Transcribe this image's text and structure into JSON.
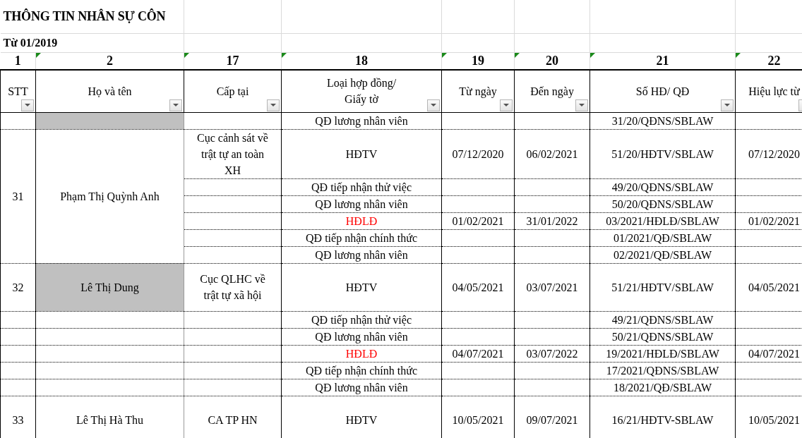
{
  "sheet": {
    "title": "THÔNG TIN NHÂN SỰ CÔN",
    "subtitle": "Từ 01/2019"
  },
  "table": {
    "columns": [
      {
        "number": "1",
        "title": "STT",
        "flagged": false,
        "filter": true
      },
      {
        "number": "2",
        "title": "Họ và tên",
        "flagged": true,
        "filter": true
      },
      {
        "number": "17",
        "title": "Cấp tại",
        "flagged": true,
        "filter": true
      },
      {
        "number": "18",
        "title": "Loại hợp đồng/\nGiấy tờ",
        "flagged": true,
        "filter": true
      },
      {
        "number": "19",
        "title": "Từ ngày",
        "flagged": true,
        "filter": true
      },
      {
        "number": "20",
        "title": "Đến ngày",
        "flagged": true,
        "filter": true
      },
      {
        "number": "21",
        "title": "Số HĐ/ QĐ",
        "flagged": true,
        "filter": true
      },
      {
        "number": "22",
        "title": "Hiệu lực từ",
        "flagged": true,
        "filter": true
      }
    ],
    "persons": [
      {
        "highlighted": true,
        "merged": true,
        "documents": [
          {
            "doc_type": "QĐ lương nhân viên",
            "color": "#000000",
            "number": "31/20/QĐNS/SBLAW"
          }
        ]
      },
      {
        "stt": "31",
        "name": "Phạm Thị Quỳnh Anh",
        "highlighted": false,
        "merged": true,
        "documents": [
          {
            "issued_at": "Cục cảnh sát về trật tự an toàn XH",
            "doc_type": "HĐTV",
            "color": "#000000",
            "from": "07/12/2020",
            "to": "06/02/2021",
            "number": "51/20/HĐTV/SBLAW",
            "effective_from": "07/12/2020"
          },
          {
            "doc_type": "QĐ tiếp nhận thử việc",
            "color": "#000000",
            "number": "49/20/QĐNS/SBLAW"
          },
          {
            "doc_type": "QĐ lương nhân viên",
            "color": "#000000",
            "number": "50/20/QĐNS/SBLAW"
          },
          {
            "doc_type": "HĐLĐ",
            "color": "#ff0000",
            "from": "01/02/2021",
            "to": "31/01/2022",
            "number": "03/2021/HĐLĐ/SBLAW",
            "effective_from": "01/02/2021"
          },
          {
            "doc_type": "QĐ tiếp nhận chính thức",
            "color": "#000000",
            "number": "01/2021/QĐ/SBLAW"
          },
          {
            "doc_type": "QĐ lương nhân viên",
            "color": "#000000",
            "number": "02/2021/QĐ/SBLAW"
          }
        ]
      },
      {
        "stt": "32",
        "name": "Lê Thị Dung",
        "highlighted": true,
        "merged": false,
        "documents": [
          {
            "issued_at": "Cục QLHC về trật tự xã hội",
            "doc_type": "HĐTV",
            "color": "#000000",
            "from": "04/05/2021",
            "to": "03/07/2021",
            "number": "51/21/HĐTV/SBLAW",
            "effective_from": "04/05/2021"
          },
          {
            "doc_type": "QĐ tiếp nhận thử việc",
            "color": "#000000",
            "number": "49/21/QĐNS/SBLAW"
          },
          {
            "doc_type": "QĐ lương nhân viên",
            "color": "#000000",
            "number": "50/21/QĐNS/SBLAW"
          },
          {
            "doc_type": "HĐLĐ",
            "color": "#ff0000",
            "from": "04/07/2021",
            "to": "03/07/2022",
            "number": "19/2021/HĐLĐ/SBLAW",
            "effective_from": "04/07/2021"
          },
          {
            "doc_type": "QĐ tiếp nhận chính thức",
            "color": "#000000",
            "number": "17/2021/QĐNS/SBLAW"
          },
          {
            "doc_type": "QĐ lương nhân viên",
            "color": "#000000",
            "number": "18/2021/QĐ/SBLAW"
          }
        ]
      },
      {
        "stt": "33",
        "name": "Lê Thị Hà Thu",
        "highlighted": false,
        "merged": true,
        "documents": [
          {
            "issued_at": "CA TP HN",
            "doc_type": "HĐTV",
            "color": "#000000",
            "from": "10/05/2021",
            "to": "09/07/2021",
            "number": "16/21/HĐTV-SBLAW",
            "effective_from": "10/05/2021"
          }
        ]
      }
    ]
  }
}
